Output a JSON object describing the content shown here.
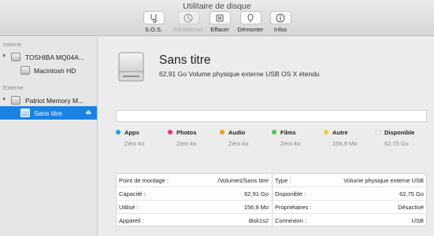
{
  "window": {
    "title": "Utilitaire de disque"
  },
  "toolbar": {
    "items": [
      {
        "label": "S.O.S.",
        "icon": "stethoscope-icon",
        "enabled": true
      },
      {
        "label": "Partitionner",
        "icon": "partition-icon",
        "enabled": false
      },
      {
        "label": "Effacer",
        "icon": "erase-icon",
        "enabled": true
      },
      {
        "label": "Démonter",
        "icon": "unmount-icon",
        "enabled": true
      },
      {
        "label": "Infos",
        "icon": "info-icon",
        "enabled": true
      }
    ]
  },
  "sidebar": {
    "internal_label": "Interne",
    "external_label": "Externe",
    "items": [
      {
        "label": "TOSHIBA MQ04A...",
        "icon": "hard-drive-icon",
        "expanded": true
      },
      {
        "label": "Macintosh HD",
        "icon": "volume-icon"
      },
      {
        "label": "Patriot Memory M...",
        "icon": "usb-drive-icon",
        "expanded": true
      },
      {
        "label": "Sans titre",
        "icon": "volume-icon",
        "selected": true,
        "eject_icon": "eject-icon"
      }
    ]
  },
  "volume": {
    "name": "Sans titre",
    "description": "62,91 Go Volume physique externe USB OS X étendu",
    "icon": "external-disk-icon"
  },
  "categories": [
    {
      "name": "Apps",
      "value": "Zéro ko",
      "color": "#1ea1e8"
    },
    {
      "name": "Photos",
      "value": "Zéro ko",
      "color": "#e8397c"
    },
    {
      "name": "Audio",
      "value": "Zéro ko",
      "color": "#f59a26"
    },
    {
      "name": "Films",
      "value": "Zéro ko",
      "color": "#4fc450"
    },
    {
      "name": "Autre",
      "value": "156,9 Mo",
      "color": "#f7cb32"
    },
    {
      "name": "Disponible",
      "value": "62,75 Go",
      "color": "#ffffff"
    }
  ],
  "info_left": [
    {
      "key": "Point de montage :",
      "value": "/Volumes/Sans titre"
    },
    {
      "key": "Capacité :",
      "value": "62,91 Go"
    },
    {
      "key": "Utilisé :",
      "value": "156,9 Mo"
    },
    {
      "key": "Appareil :",
      "value": "disk1s2"
    }
  ],
  "info_right": [
    {
      "key": "Type :",
      "value": "Volume physique externe USB"
    },
    {
      "key": "Disponible :",
      "value": "62,75 Go"
    },
    {
      "key": "Propriétaires :",
      "value": "Désactivé"
    },
    {
      "key": "Connexion :",
      "value": "USB"
    }
  ],
  "colors": {
    "accent": "#1a82e2"
  }
}
